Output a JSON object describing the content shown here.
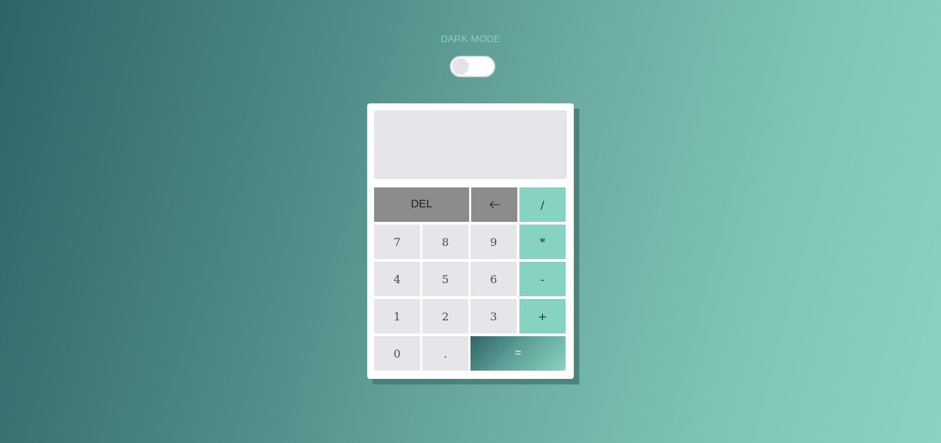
{
  "theme_toggle": {
    "label": "DARK MODE",
    "enabled": false
  },
  "display": {
    "value": ""
  },
  "keys": {
    "del": "DEL",
    "backspace_icon": "arrow-left-icon",
    "divide": "/",
    "multiply": "*",
    "subtract": "-",
    "add": "+",
    "equals": "=",
    "decimal": ".",
    "digits": {
      "d0": "0",
      "d1": "1",
      "d2": "2",
      "d3": "3",
      "d4": "4",
      "d5": "5",
      "d6": "6",
      "d7": "7",
      "d8": "8",
      "d9": "9"
    }
  },
  "colors": {
    "accent": "#86d3c1",
    "key_bg": "#e6e5e9",
    "control_key_bg": "#8c8c8c",
    "digit_text": "#2f5557"
  }
}
